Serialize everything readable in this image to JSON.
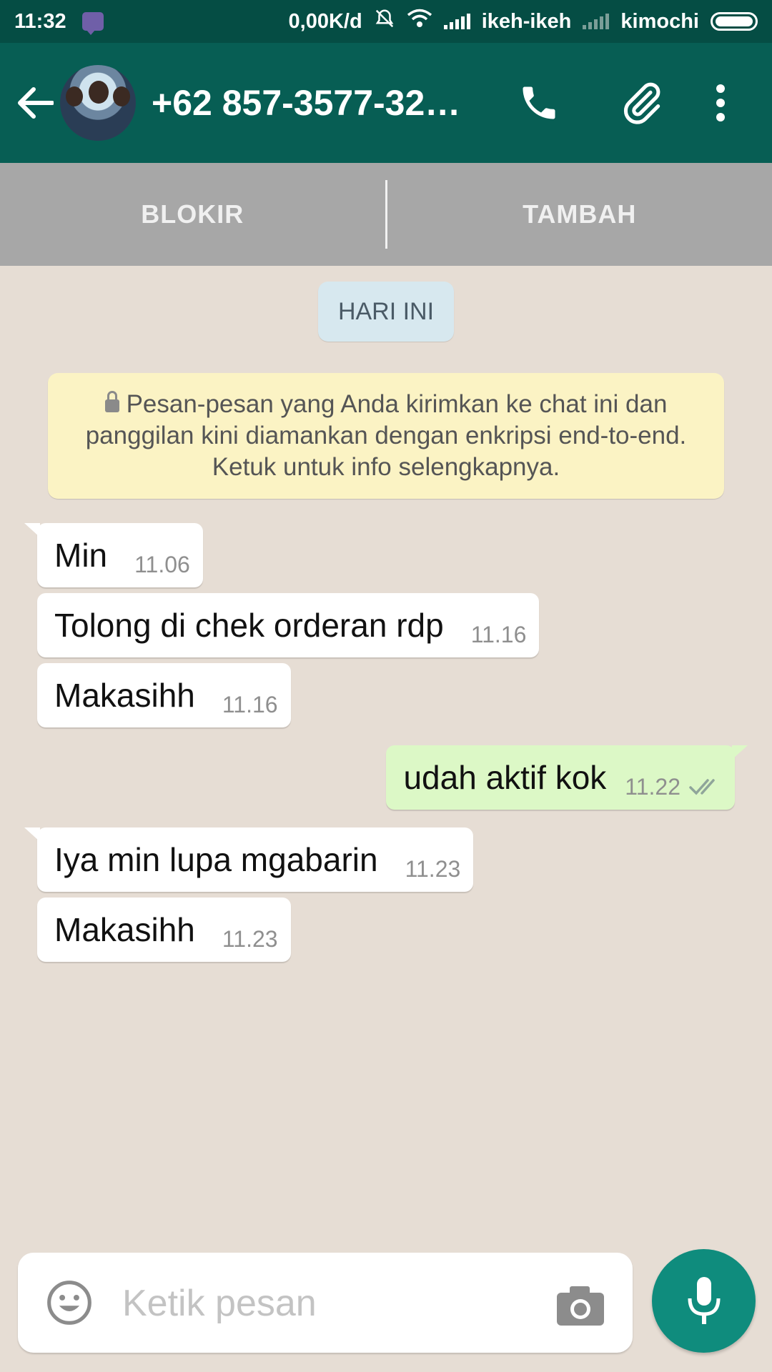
{
  "status_bar": {
    "time": "11:32",
    "speed": "0,00K/d",
    "carrier1": "ikeh-ikeh",
    "carrier2": "kimochi"
  },
  "header": {
    "title": "+62 857-3577-32…"
  },
  "actions": {
    "block_label": "BLOKIR",
    "add_label": "TAMBAH"
  },
  "chat": {
    "date_label": "HARI INI",
    "encryption_notice": "Pesan-pesan yang Anda kirimkan ke chat ini dan panggilan kini diamankan dengan enkripsi end-to-end. Ketuk untuk info selengkapnya.",
    "messages": [
      {
        "direction": "incoming",
        "text": "Min",
        "time": "11.06"
      },
      {
        "direction": "incoming",
        "text": "Tolong di chek orderan rdp",
        "time": "11.16"
      },
      {
        "direction": "incoming",
        "text": "Makasihh",
        "time": "11.16"
      },
      {
        "direction": "outgoing",
        "text": "udah aktif kok",
        "time": "11.22",
        "status": "read"
      },
      {
        "direction": "incoming",
        "text": "Iya min lupa mgabarin",
        "time": "11.23"
      },
      {
        "direction": "incoming",
        "text": "Makasihh",
        "time": "11.23"
      }
    ]
  },
  "composer": {
    "placeholder": "Ketik pesan"
  },
  "colors": {
    "status_bar": "#054d44",
    "app_bar": "#075e54",
    "outgoing_bubble": "#dcf8c6",
    "incoming_bubble": "#ffffff",
    "notice_bg": "#fbf3c4",
    "mic_button": "#0f8c7d"
  },
  "icons": [
    "back-arrow-icon",
    "call-icon",
    "attach-icon",
    "more-vert-icon",
    "lock-icon",
    "double-check-icon",
    "emoji-icon",
    "camera-icon",
    "mic-icon",
    "bbm-icon",
    "silent-icon",
    "wifi-icon",
    "signal-icon",
    "battery-icon"
  ]
}
